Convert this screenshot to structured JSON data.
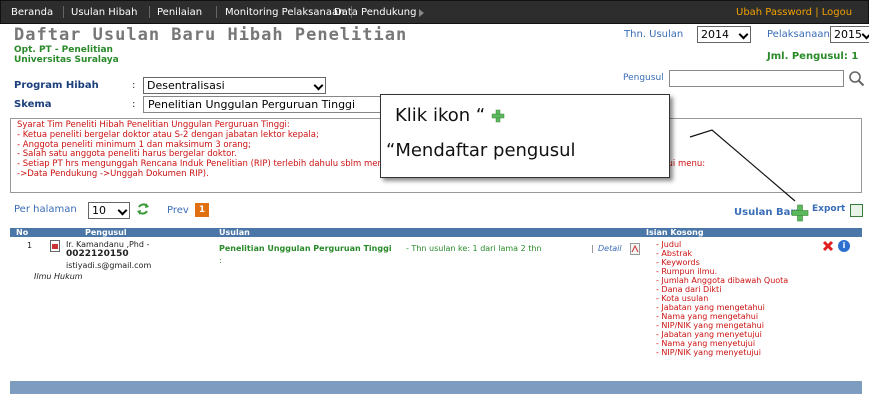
{
  "nav": {
    "items": [
      "Beranda",
      "Usulan Hibah",
      "Penilaian",
      "Monitoring Pelaksanaan",
      "Data Pendukung"
    ],
    "right": "Ubah Password | Logou"
  },
  "header": {
    "title": "Daftar Usulan Baru Hibah Penelitian",
    "org_line1": "Opt. PT - Penelitian",
    "org_line2": "Universitas Suralaya",
    "thn_label": "Thn. Usulan",
    "thn_value": "2014",
    "pelaksanaan_label": "Pelaksanaan",
    "pelaksanaan_value": "2015",
    "jml_label": "Jml. Pengusul: 1"
  },
  "form": {
    "program_label": "Program Hibah",
    "program_value": "Desentralisasi",
    "skema_label": "Skema",
    "skema_value": "Penelitian Unggulan Perguruan Tinggi",
    "colon": ":",
    "pengusul_label": "Pengusul",
    "pengusul_value": ""
  },
  "syarat": {
    "lines": [
      "Syarat Tim Peneliti Hibah Penelitian Unggulan Perguruan Tinggi:",
      "- Ketua peneliti bergelar doktor atau S-2 dengan jabatan lektor kepala;",
      "- Anggota peneliti minimum 1 dan maksimum 3 orang;",
      "- Salah satu anggota peneliti harus bergelar doktor.",
      "- Setiap PT hrs mengunggah Rencana Induk Penelitian (RIP) terlebih dahulu sblm mendaftarkan usulan dengan skema Unggulan Perguruan Tinggi (melalui menu:",
      "->Data Pendukung ->Unggah Dokumen RIP)."
    ]
  },
  "callout": {
    "line1": "Klik ikon “",
    "line2": "“Mendaftar pengusul"
  },
  "toolbar": {
    "per_halaman_label": "Per halaman",
    "per_halaman_value": "10",
    "prev_label": "Prev",
    "page": "1",
    "usulan_baru_label": "Usulan Baru",
    "export_label": "Export"
  },
  "table": {
    "headers": [
      "No",
      "Pengusul",
      "Usulan",
      "Isian Kosong"
    ],
    "rows": [
      {
        "no": "1",
        "name": "Ir. Kamandanu ,Phd -",
        "nidn": "0022120150",
        "email": "istiyadi.s@gmail.com",
        "bidang": "Ilmu Hukum",
        "usulan_title": "Penelitian Unggulan Perguruan Tinggi",
        "usulan_meta": " - Thn usulan ke: 1 dari lama 2 thn",
        "usulan_colon": ":",
        "detail_label": "Detail",
        "isian_kosong": [
          "- Judul",
          "- Abstrak",
          "- Keywords",
          "- Rumpun ilmu.",
          "- Jumlah Anggota dibawah Quota",
          "- Dana dari Dikti",
          "- Kota usulan",
          "- Jabatan yang mengetahui",
          "- Nama yang mengetahui",
          "- NIP/NIK yang mengetahui",
          "- Jabatan yang menyetujui",
          "- Nama yang menyetujui",
          "- NIP/NIK yang menyetujui"
        ]
      }
    ]
  },
  "icons": {
    "search": "search-icon",
    "refresh": "refresh-icon",
    "add": "plus-icon",
    "export": "excel-icon",
    "delete": "delete-icon",
    "info": "info-icon",
    "pdf": "pdf-icon"
  },
  "colors": {
    "nav_bg": "#2d2d2d",
    "accent_blue": "#3a6db8",
    "green": "#2a8a2a",
    "red": "#cc1111",
    "table_header": "#4a76a8",
    "orange": "#e07010"
  }
}
